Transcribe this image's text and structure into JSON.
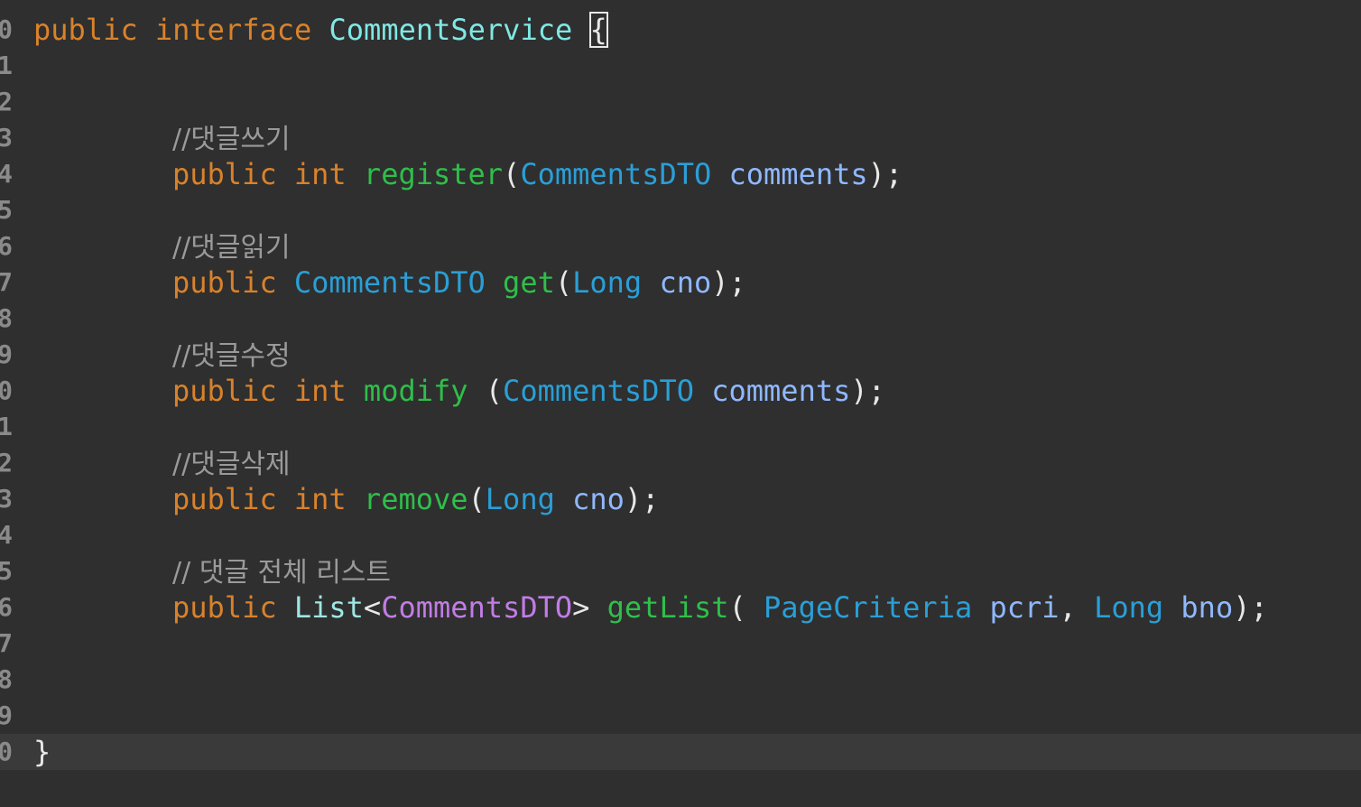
{
  "gutter": {
    "line_numbers": [
      "0",
      "1",
      "2",
      "3",
      "4",
      "5",
      "6",
      "7",
      "8",
      "9",
      "0",
      "1",
      "2",
      "3",
      "4",
      "5",
      "6",
      "7",
      "8",
      "9",
      "0"
    ]
  },
  "code": {
    "l0": {
      "kw1": "public",
      "kw2": "interface",
      "name": "CommentService",
      "brace": "{"
    },
    "l3": {
      "comment": "//댓글쓰기"
    },
    "l4": {
      "kw": "public",
      "ret": "int",
      "method": "register",
      "open": "(",
      "ptype": "CommentsDTO",
      "pname": "comments",
      "close": ");"
    },
    "l6": {
      "comment": "//댓글읽기"
    },
    "l7": {
      "kw": "public",
      "ret": "CommentsDTO",
      "method": "get",
      "open": "(",
      "ptype": "Long",
      "pname": "cno",
      "close": ");"
    },
    "l9": {
      "comment": "//댓글수정"
    },
    "l10": {
      "kw": "public",
      "ret": "int",
      "method": "modify",
      "open": "(",
      "ptype": "CommentsDTO",
      "pname": "comments",
      "close": ");"
    },
    "l12": {
      "comment": "//댓글삭제"
    },
    "l13": {
      "kw": "public",
      "ret": "int",
      "method": "remove",
      "open": "(",
      "ptype": "Long",
      "pname": "cno",
      "close": ");"
    },
    "l15": {
      "comment": "// 댓글 전체 리스트"
    },
    "l16": {
      "kw": "public",
      "ret": "List",
      "lt": "<",
      "generic": "CommentsDTO",
      "gt": ">",
      "method": "getList",
      "open": "(",
      "ptype1": "PageCriteria",
      "pname1": "pcri",
      "comma": ",",
      "ptype2": "Long",
      "pname2": "bno",
      "close": ");"
    },
    "l20": {
      "brace": "}"
    }
  },
  "colors": {
    "background": "#2f2f2f",
    "current_line": "#3a3a3a",
    "keyword": "#d9822b",
    "interface_name": "#7fe8e4",
    "type": "#2a9fd6",
    "method": "#2fbf4a",
    "parameter": "#8fb8ff",
    "generic": "#c27ce6",
    "comment": "#9a9a9a"
  }
}
